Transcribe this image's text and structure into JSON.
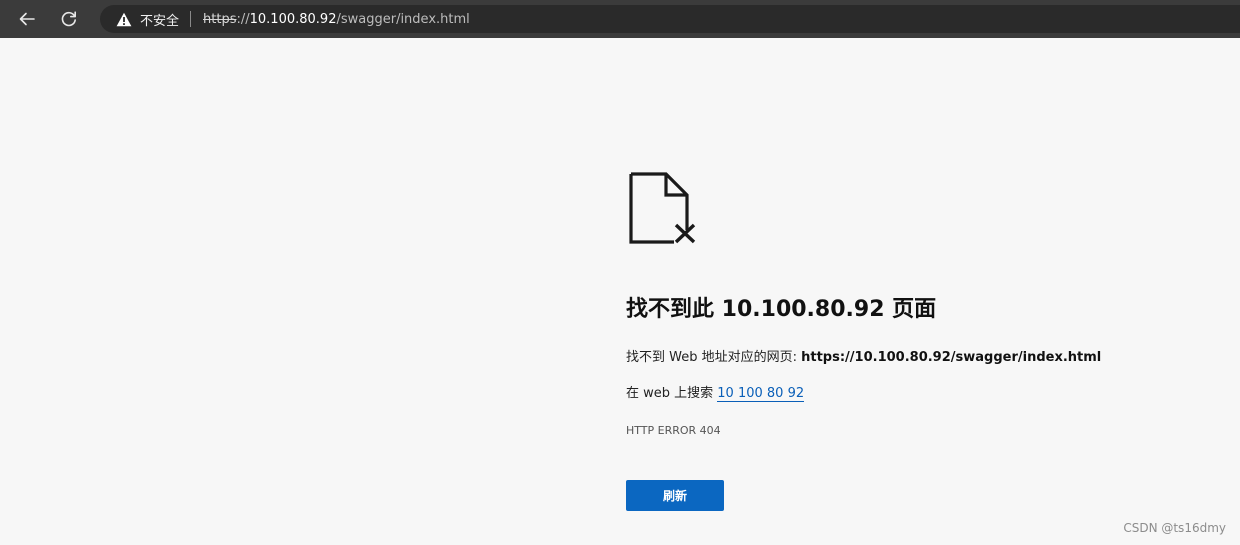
{
  "toolbar": {
    "back_icon": "back-arrow-icon",
    "reload_icon": "reload-icon",
    "security_icon": "warning-icon",
    "security_label": "不安全",
    "url_scheme": "https",
    "url_sep": "://",
    "url_host": "10.100.80.92",
    "url_path": "/swagger/index.html"
  },
  "error_page": {
    "icon": "document-x-icon",
    "title": "找不到此 10.100.80.92 页面",
    "line1_prefix": "找不到 Web 地址对应的网页: ",
    "line1_url": "https://10.100.80.92/swagger/index.html",
    "line2_prefix": "在 web 上搜索 ",
    "search_link": "10 100 80 92",
    "error_code": "HTTP ERROR 404",
    "refresh_button": "刷新"
  },
  "watermark": "CSDN @ts16dmy",
  "colors": {
    "toolbar_bg": "#3b3b3b",
    "page_bg": "#f7f7f7",
    "button_bg": "#0b67c1",
    "link": "#0a5fb8"
  }
}
